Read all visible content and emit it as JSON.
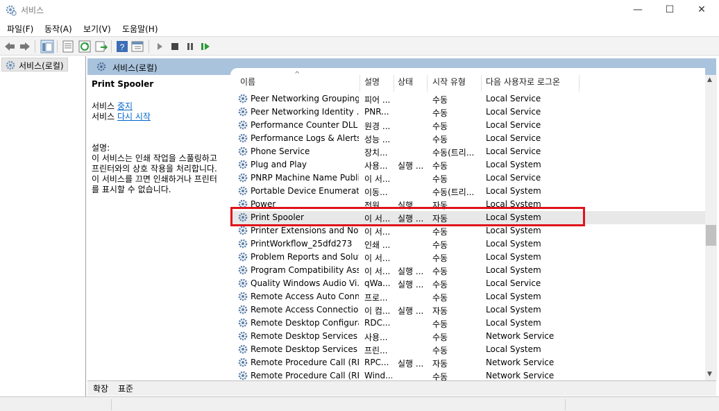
{
  "window": {
    "title": "서비스",
    "minimize": "—",
    "maximize": "☐",
    "close": "✕"
  },
  "menu": [
    {
      "label": "파일(F)"
    },
    {
      "label": "동작(A)"
    },
    {
      "label": "보기(V)"
    },
    {
      "label": "도움말(H)"
    }
  ],
  "toolbar": {
    "icons": [
      "back-icon",
      "forward-icon",
      "show-tree-icon",
      "properties-icon",
      "refresh-icon",
      "export-icon",
      "help-icon",
      "view-icon",
      "play-icon",
      "stop-icon",
      "pause-icon",
      "restart-icon"
    ]
  },
  "tree": {
    "root_label": "서비스(로컬)"
  },
  "panel": {
    "header": "서비스(로컬)"
  },
  "description": {
    "service_name": "Print Spooler",
    "line1_prefix": "서비스 ",
    "stop_link": "중지",
    "line2_prefix": "서비스 ",
    "restart_link": "다시 시작",
    "desc_label": "설명:",
    "desc_lines": [
      "이 서비스는 인쇄 작업을 스풀링하고",
      "프린터와의 상호 작용을 처리합니다.",
      "이 서비스를 끄면 인쇄하거나 프린터",
      "를 표시할 수 없습니다."
    ]
  },
  "columns": {
    "sort_indicator": "^",
    "name": "이름",
    "description": "설명",
    "status": "상태",
    "startup": "시작 유형",
    "logon": "다음 사용자로 로그온"
  },
  "services": [
    {
      "name": "Peer Networking Grouping",
      "desc": "피어 ...",
      "status": "",
      "startup": "수동",
      "logon": "Local Service"
    },
    {
      "name": "Peer Networking Identity ...",
      "desc": "PNR...",
      "status": "",
      "startup": "수동",
      "logon": "Local Service"
    },
    {
      "name": "Performance Counter DLL ...",
      "desc": "원경 ...",
      "status": "",
      "startup": "수동",
      "logon": "Local Service"
    },
    {
      "name": "Performance Logs & Alerts",
      "desc": "성능 ...",
      "status": "",
      "startup": "수동",
      "logon": "Local Service"
    },
    {
      "name": "Phone Service",
      "desc": "장치...",
      "status": "",
      "startup": "수동(트리...",
      "logon": "Local Service"
    },
    {
      "name": "Plug and Play",
      "desc": "사용...",
      "status": "실행 ...",
      "startup": "수동",
      "logon": "Local System"
    },
    {
      "name": "PNRP Machine Name Publi...",
      "desc": "이 서...",
      "status": "",
      "startup": "수동",
      "logon": "Local Service"
    },
    {
      "name": "Portable Device Enumerato...",
      "desc": "이동...",
      "status": "",
      "startup": "수동(트리...",
      "logon": "Local System"
    },
    {
      "name": "Power",
      "desc": "전원...",
      "status": "실행 ...",
      "startup": "자동",
      "logon": "Local System"
    },
    {
      "name": "Print Spooler",
      "desc": "이 서...",
      "status": "실행 ...",
      "startup": "자동",
      "logon": "Local System",
      "selected": true
    },
    {
      "name": "Printer Extensions and Noti...",
      "desc": "이 서...",
      "status": "",
      "startup": "수동",
      "logon": "Local System"
    },
    {
      "name": "PrintWorkflow_25dfd273",
      "desc": "인쇄 ...",
      "status": "",
      "startup": "수동",
      "logon": "Local System"
    },
    {
      "name": "Problem Reports and Solut...",
      "desc": "이 서...",
      "status": "",
      "startup": "수동",
      "logon": "Local System"
    },
    {
      "name": "Program Compatibility Assi...",
      "desc": "이 서...",
      "status": "실행 ...",
      "startup": "수동",
      "logon": "Local System"
    },
    {
      "name": "Quality Windows Audio Vi...",
      "desc": "qWa...",
      "status": "실행 ...",
      "startup": "수동",
      "logon": "Local Service"
    },
    {
      "name": "Remote Access Auto Conn...",
      "desc": "프로...",
      "status": "",
      "startup": "수동",
      "logon": "Local System"
    },
    {
      "name": "Remote Access Connection...",
      "desc": "이 컴...",
      "status": "실행 ...",
      "startup": "자동",
      "logon": "Local System"
    },
    {
      "name": "Remote Desktop Configura...",
      "desc": "RDC...",
      "status": "",
      "startup": "수동",
      "logon": "Local System"
    },
    {
      "name": "Remote Desktop Services",
      "desc": "사용...",
      "status": "",
      "startup": "수동",
      "logon": "Network Service"
    },
    {
      "name": "Remote Desktop Services ...",
      "desc": "프린...",
      "status": "",
      "startup": "수동",
      "logon": "Local System"
    },
    {
      "name": "Remote Procedure Call (RP...",
      "desc": "RPC...",
      "status": "실행 ...",
      "startup": "자동",
      "logon": "Network Service"
    },
    {
      "name": "Remote Procedure Call (RP...",
      "desc": "Wind...",
      "status": "",
      "startup": "수동",
      "logon": "Network Service"
    }
  ],
  "tabs": [
    {
      "label": "확장"
    },
    {
      "label": "표준"
    }
  ],
  "colors": {
    "highlight": "#e0121a",
    "header_band": "#a9c3dd",
    "link": "#0066cc"
  }
}
